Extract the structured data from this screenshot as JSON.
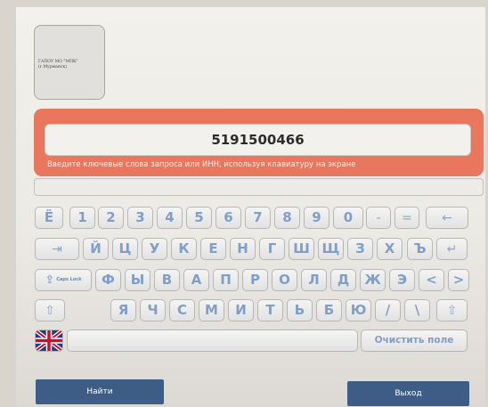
{
  "logo": {
    "org_line1": "ГАПОУ МО \"МПК\"",
    "org_line2": "(г.Мурманск)"
  },
  "search": {
    "value": "5191500466",
    "hint": "Введите ключевые слова запроса или ИНН, используя клавиатуру на экране"
  },
  "keyboard": {
    "row1": [
      "Ё",
      "1",
      "2",
      "3",
      "4",
      "5",
      "6",
      "7",
      "8",
      "9",
      "0",
      "-",
      "=",
      "←"
    ],
    "row2": [
      "⇥",
      "Й",
      "Ц",
      "У",
      "К",
      "Е",
      "Н",
      "Г",
      "Ш",
      "Щ",
      "З",
      "Х",
      "Ъ",
      "↵"
    ],
    "row3_caps": "Caps Lock",
    "row3": [
      "Ф",
      "Ы",
      "В",
      "А",
      "П",
      "Р",
      "О",
      "Л",
      "Д",
      "Ж",
      "Э",
      "<",
      ">"
    ],
    "row4": [
      "⇧",
      "Я",
      "Ч",
      "С",
      "М",
      "И",
      "Т",
      "Ь",
      "Б",
      "Ю",
      "/",
      "\\",
      "⇧"
    ],
    "clear_label": "Очистить поле",
    "language_icon": "uk-flag-icon"
  },
  "buttons": {
    "find_label": "Найти",
    "exit_label": "Выход"
  },
  "colors": {
    "accent": "#e8775e",
    "key_text": "#7f9fc9",
    "button_bg": "#3d5c86"
  }
}
